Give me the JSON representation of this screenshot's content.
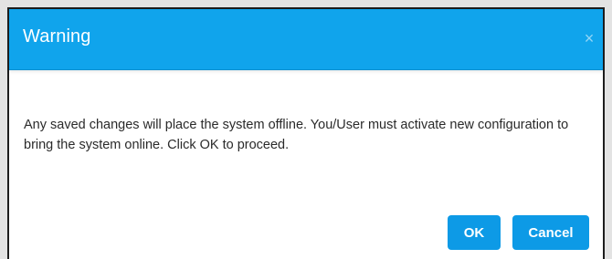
{
  "dialog": {
    "title": "Warning",
    "close_icon": "×",
    "message": "Any saved changes will place the system offline. You/User must activate new configuration to bring the system online. Click OK to proceed.",
    "ok_label": "OK",
    "cancel_label": "Cancel"
  },
  "colors": {
    "header": "#10a4ec",
    "button": "#0d9ae6"
  }
}
